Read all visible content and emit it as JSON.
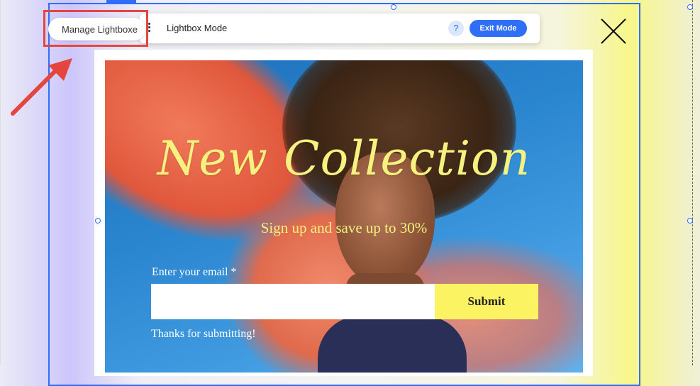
{
  "toolbar": {
    "mode_title": "Lightbox Mode",
    "help_label": "?",
    "exit_label": "Exit Mode"
  },
  "manage": {
    "label": "Manage Lightboxe"
  },
  "lightbox": {
    "headline": "New Collection",
    "subline": "Sign up and save up to 30%",
    "email_label": "Enter your email *",
    "email_value": "",
    "submit_label": "Submit",
    "success_message": "Thanks for submitting!"
  },
  "colors": {
    "selection": "#2f6ef7",
    "accent_yellow": "#fbf361",
    "annotation_red": "#e5453f"
  },
  "icons": {
    "close": "close-icon",
    "drag": "drag-handle-icon",
    "help": "help-icon",
    "arrow": "annotation-arrow"
  }
}
